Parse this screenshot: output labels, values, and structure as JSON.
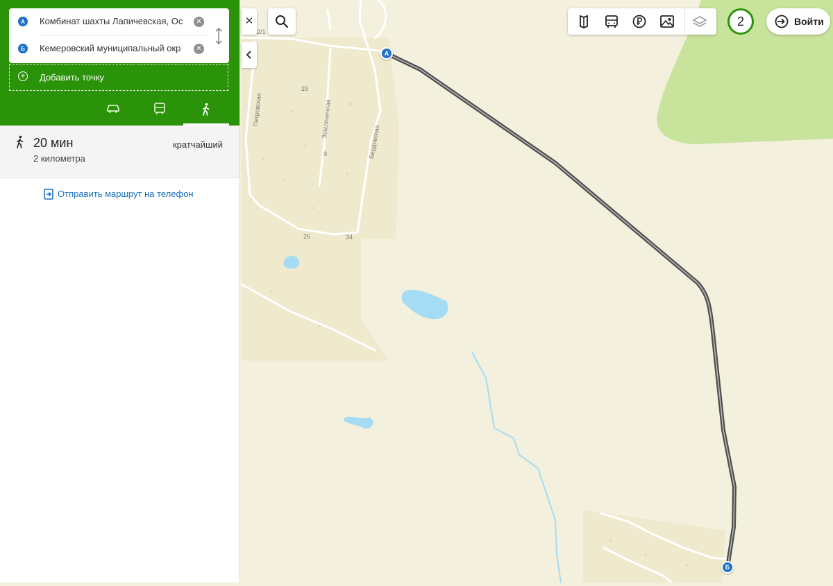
{
  "route": {
    "point_a": {
      "badge": "А",
      "text": "Комбинат шахты Лапичевская, Ос"
    },
    "point_b": {
      "badge": "Б",
      "text": "Кемеровский муниципальный окр"
    },
    "add_point": "Добавить точку",
    "modes": [
      {
        "name": "car",
        "icon": "car-icon",
        "active": false
      },
      {
        "name": "transit",
        "icon": "bus-icon",
        "active": false
      },
      {
        "name": "walk",
        "icon": "walk-icon",
        "active": true
      }
    ]
  },
  "result": {
    "time": "20 мин",
    "distance": "2 километра",
    "tag": "кратчайший"
  },
  "send_route": "Отправить маршрут на телефон",
  "map": {
    "streets": [
      "Петровская",
      "Земляничная",
      "Бердовская"
    ],
    "house_numbers": [
      "29",
      "9",
      "26",
      "34",
      "2/1"
    ],
    "markers": [
      "А",
      "Б"
    ],
    "route_color": "#5a5a5a"
  },
  "toolbar": {
    "icons": [
      "sights-icon",
      "transport-icon",
      "ruble-icon",
      "photo-icon",
      "layers-icon"
    ]
  },
  "badge_count": "2",
  "login_label": "Войти",
  "colors": {
    "accent": "#2b9309",
    "link": "#1a6fbf",
    "water": "#a5dcf3",
    "forest": "#c7e29a"
  }
}
